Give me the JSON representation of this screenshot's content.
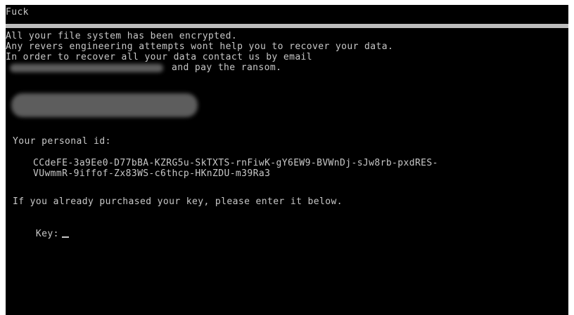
{
  "window": {
    "title": "Fuck"
  },
  "message": {
    "lines": [
      "All your file system has been encrypted.",
      "Any revers engineering attempts wont help you to recover your data.",
      "In order to recover all your data contact us by email",
      "and pay the ransom."
    ]
  },
  "personal_id": {
    "label": "Your personal id:",
    "line1": "CCdeFE-3a9Ee0-D77bBA-KZRG5u-SkTXTS-rnFiwK-gY6EW9-BVWnDj-sJw8rb-pxdRES-",
    "line2": "VUwmmR-9iffof-Zx83WS-c6thcp-HKnZDU-m39Ra3"
  },
  "prompt": {
    "text": "If you already purchased your key, please enter it below."
  },
  "key_input": {
    "label": "Key:",
    "value": ""
  },
  "colors": {
    "background": "#000000",
    "text": "#c8c8c8",
    "separator": "#bdbdbd"
  }
}
